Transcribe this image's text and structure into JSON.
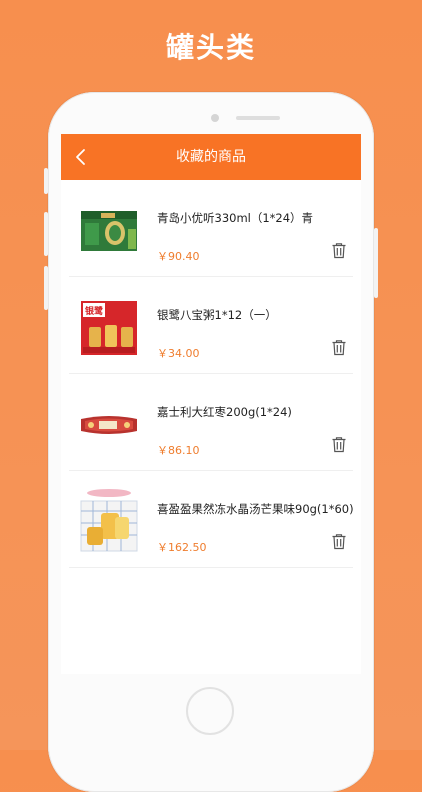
{
  "promo": {
    "headline": "罐头类"
  },
  "header": {
    "back_icon": "chevron-left-icon",
    "title": "收藏的商品"
  },
  "colors": {
    "accent": "#f87325",
    "price": "#ef7d2e",
    "background": "#f78f4e"
  },
  "favorites": [
    {
      "name": "青岛小优听330ml（1*24）青",
      "price": "￥90.40",
      "icon": "beer-case-image"
    },
    {
      "name": "银鹭八宝粥1*12（一）",
      "price": "￥34.00",
      "icon": "congee-box-image"
    },
    {
      "name": "嘉士利大红枣200g(1*24)",
      "price": "￥86.10",
      "icon": "biscuit-pack-image"
    },
    {
      "name": "喜盈盈果然冻水晶汤芒果味90g(1*60)",
      "price": "￥162.50",
      "icon": "jelly-pack-image"
    }
  ]
}
